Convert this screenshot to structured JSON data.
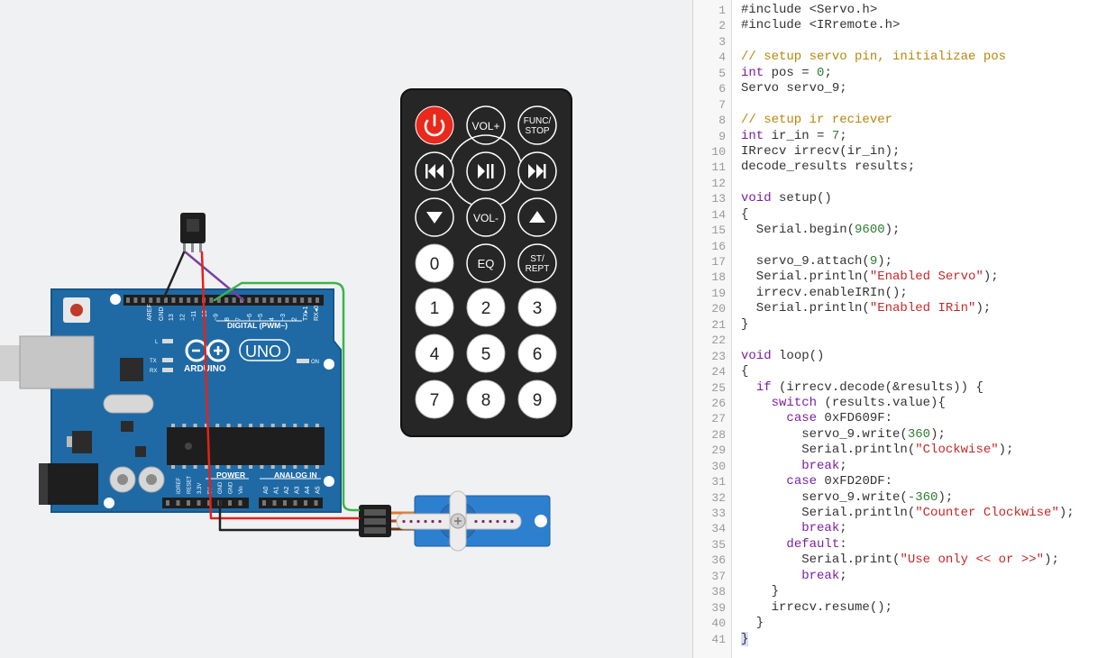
{
  "board": {
    "labels": {
      "aref": "AREF",
      "gnd": "GND",
      "pins": [
        "13",
        "12",
        "~11",
        "~10",
        "~9",
        "8",
        "7",
        "~6",
        "~5",
        "4",
        "~3",
        "2",
        "TX▸1",
        "RX◂0"
      ],
      "digital": "DIGITAL (PWM~)",
      "l": "L",
      "tx": "TX",
      "rx": "RX",
      "on": "ON",
      "logo_text": "ARDUINO",
      "model": "UNO",
      "power": "POWER",
      "analog_in": "ANALOG IN",
      "power_pins": [
        "IOREF",
        "RESET",
        "3.3V",
        "5V",
        "GND",
        "GND",
        "Vin"
      ],
      "analog_pins": [
        "A0",
        "A1",
        "A2",
        "A3",
        "A4",
        "A5"
      ]
    }
  },
  "remote": {
    "power_icon": "power-icon",
    "row1": [
      "VOL+",
      "FUNC/ STOP"
    ],
    "row2_icons": [
      "rewind-icon",
      "play-pause-icon",
      "fast-forward-icon"
    ],
    "row3": {
      "down_icon": "triangle-down-icon",
      "vol_minus": "VOL-",
      "up_icon": "triangle-up-icon"
    },
    "row4": [
      "0",
      "EQ",
      "ST/ REPT"
    ],
    "digits": [
      "1",
      "2",
      "3",
      "4",
      "5",
      "6",
      "7",
      "8",
      "9"
    ]
  },
  "colors": {
    "board": "#1f6aa5",
    "wire_red": "#e2231a",
    "wire_green": "#3ab54a",
    "wire_black": "#222222",
    "wire_purple": "#7b3fa0",
    "power_button": "#e8291c",
    "servo": "#2d7fd0"
  },
  "editor": {
    "lines": [
      [
        [
          "#include <Servo.h>",
          "p"
        ]
      ],
      [
        [
          "#include <IRremote.h>",
          "p"
        ]
      ],
      [],
      [
        [
          "// setup servo pin, initializae pos",
          "c"
        ]
      ],
      [
        [
          "int",
          "k"
        ],
        [
          " pos = ",
          "p"
        ],
        [
          "0",
          "n"
        ],
        [
          ";",
          "p"
        ]
      ],
      [
        [
          "Servo servo_9;",
          "p"
        ]
      ],
      [],
      [
        [
          "// setup ir reciever",
          "c"
        ]
      ],
      [
        [
          "int",
          "k"
        ],
        [
          " ir_in = ",
          "p"
        ],
        [
          "7",
          "n"
        ],
        [
          ";",
          "p"
        ]
      ],
      [
        [
          "IRrecv irrecv(ir_in);",
          "p"
        ]
      ],
      [
        [
          "decode_results results;",
          "p"
        ]
      ],
      [],
      [
        [
          "void",
          "k"
        ],
        [
          " setup()",
          "p"
        ]
      ],
      [
        [
          "{",
          "p"
        ]
      ],
      [
        [
          "  Serial.begin(",
          "p"
        ],
        [
          "9600",
          "n"
        ],
        [
          ");",
          "p"
        ]
      ],
      [],
      [
        [
          "  servo_9.attach(",
          "p"
        ],
        [
          "9",
          "n"
        ],
        [
          ");",
          "p"
        ]
      ],
      [
        [
          "  Serial.println(",
          "p"
        ],
        [
          "\"Enabled Servo\"",
          "s"
        ],
        [
          ");",
          "p"
        ]
      ],
      [
        [
          "  irrecv.enableIRIn();",
          "p"
        ]
      ],
      [
        [
          "  Serial.println(",
          "p"
        ],
        [
          "\"Enabled IRin\"",
          "s"
        ],
        [
          ");",
          "p"
        ]
      ],
      [
        [
          "}",
          "p"
        ]
      ],
      [],
      [
        [
          "void",
          "k"
        ],
        [
          " loop()",
          "p"
        ]
      ],
      [
        [
          "{",
          "p"
        ]
      ],
      [
        [
          "  ",
          "p"
        ],
        [
          "if",
          "k"
        ],
        [
          " (irrecv.decode(&results)) {",
          "p"
        ]
      ],
      [
        [
          "    ",
          "p"
        ],
        [
          "switch",
          "k"
        ],
        [
          " (results.value){",
          "p"
        ]
      ],
      [
        [
          "      ",
          "p"
        ],
        [
          "case",
          "k"
        ],
        [
          " 0xFD609F:",
          "p"
        ]
      ],
      [
        [
          "        servo_9.write(",
          "p"
        ],
        [
          "360",
          "n"
        ],
        [
          ");",
          "p"
        ]
      ],
      [
        [
          "        Serial.println(",
          "p"
        ],
        [
          "\"Clockwise\"",
          "s"
        ],
        [
          ");",
          "p"
        ]
      ],
      [
        [
          "        ",
          "p"
        ],
        [
          "break",
          "k"
        ],
        [
          ";",
          "p"
        ]
      ],
      [
        [
          "      ",
          "p"
        ],
        [
          "case",
          "k"
        ],
        [
          " 0xFD20DF:",
          "p"
        ]
      ],
      [
        [
          "        servo_9.write(",
          "p"
        ],
        [
          "-360",
          "n"
        ],
        [
          ");",
          "p"
        ]
      ],
      [
        [
          "        Serial.println(",
          "p"
        ],
        [
          "\"Counter Clockwise\"",
          "s"
        ],
        [
          ");",
          "p"
        ]
      ],
      [
        [
          "        ",
          "p"
        ],
        [
          "break",
          "k"
        ],
        [
          ";",
          "p"
        ]
      ],
      [
        [
          "      ",
          "p"
        ],
        [
          "default",
          "k"
        ],
        [
          ":",
          "p"
        ]
      ],
      [
        [
          "        Serial.print(",
          "p"
        ],
        [
          "\"Use only << or >>\"",
          "s"
        ],
        [
          ");",
          "p"
        ]
      ],
      [
        [
          "        ",
          "p"
        ],
        [
          "break",
          "k"
        ],
        [
          ";",
          "p"
        ]
      ],
      [
        [
          "    }",
          "p"
        ]
      ],
      [
        [
          "    irrecv.resume();",
          "p"
        ]
      ],
      [
        [
          "  }",
          "p"
        ]
      ],
      [
        [
          "}",
          "cursor"
        ]
      ]
    ]
  }
}
